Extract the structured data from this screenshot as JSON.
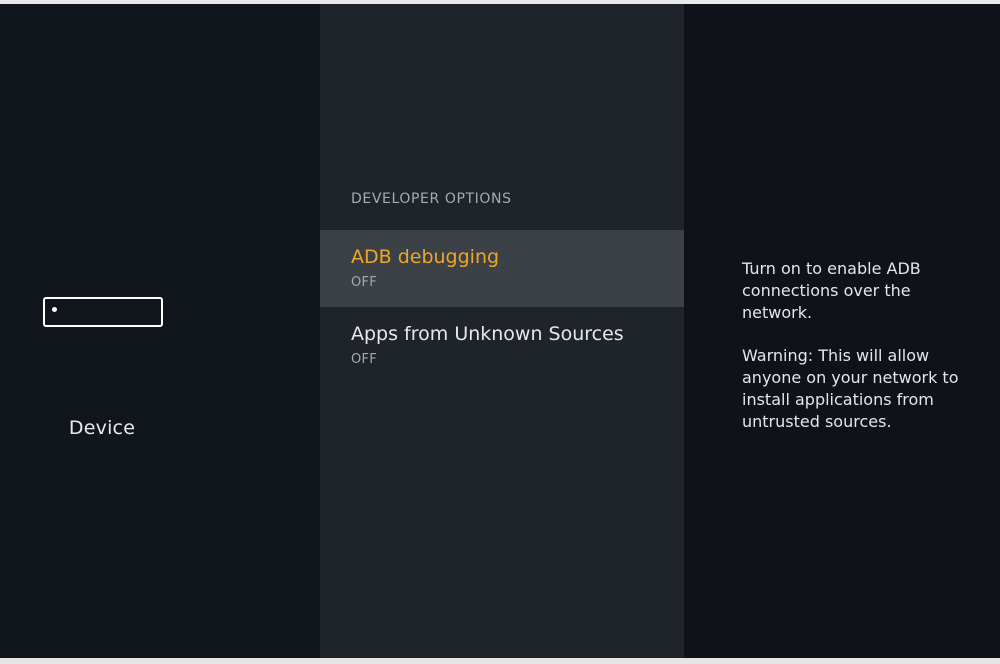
{
  "sidebar": {
    "device_label": "Device",
    "icon": "fire-tv-device-icon"
  },
  "main": {
    "section_header": "DEVELOPER OPTIONS",
    "items": [
      {
        "title": "ADB debugging",
        "value": "OFF",
        "selected": true
      },
      {
        "title": "Apps from Unknown Sources",
        "value": "OFF",
        "selected": false
      }
    ]
  },
  "detail": {
    "paragraph1": "Turn on to enable ADB connections over the network.",
    "paragraph2": "Warning: This will allow anyone on your network to install applications from untrusted sources."
  },
  "colors": {
    "selected_text": "#f0a624",
    "selected_background": "#3b4147",
    "menu_background": "#1e242a",
    "page_background": "#11151c"
  }
}
